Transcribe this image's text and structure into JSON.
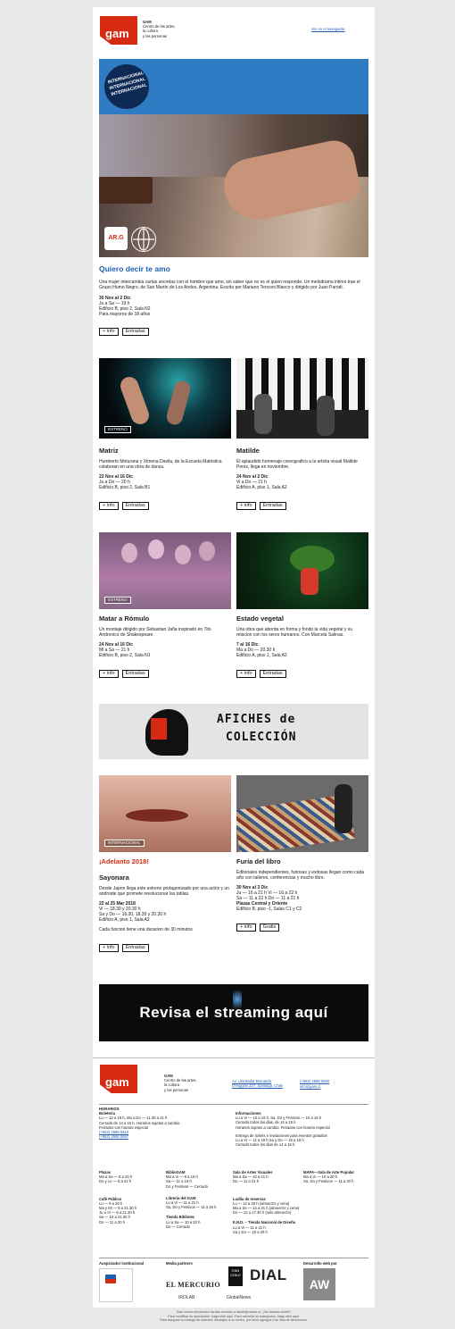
{
  "header": {
    "org": "GAM",
    "org_lines": [
      "Centro de las artes,",
      "la cultura",
      "y las personas"
    ],
    "browser_link": "Ver en el navegador"
  },
  "banner": {
    "stamp_word": "INTERNACIONAL"
  },
  "feature": {
    "title": "Quiero decir te amo",
    "desc": "Una mujer intercambia cartas secretas con el hombre que amo, sin saber que no es el quien responde. Un melodrama intimo trae el Grupo Humo Negro, de San Martin de Los Andes, Argentina. Escrito por Mariano Tenconi Blanco y dirigido por Juan Parodi.",
    "date": "30 Nov al 2 Dic",
    "times": "Ju a Sa — 19 h",
    "place": "Edificio B, piso 2, Sala N2",
    "age": "Para mayores de 18 años",
    "logo_text": "AR.G"
  },
  "buttons": {
    "info": "+ info",
    "tickets": "Entradas",
    "free": "Gratis"
  },
  "badges": {
    "estreno": "ESTRENO",
    "internacional": "INTERNACIONAL"
  },
  "events": [
    {
      "title": "Matriz",
      "desc": "Humberto Moturana y Ximena Davila, de la Escuela Matristica colaboran en una obra de danza.",
      "date": "22 Nov al 16 Dic",
      "times": "Ju a Do — 20 h",
      "place": "Edificio B, piso 2, Sala B1"
    },
    {
      "title": "Matilde",
      "desc": "El aplaudido homenaje coreografico a la artista visual Matilde Perez, llega en noviembre.",
      "date": "24 Nov al 2 Dic",
      "times": "Vi a Do — 21 h",
      "place": "Edificio A, piso 1, Sala A2"
    },
    {
      "title": "Matar a Rómulo",
      "desc": "Un montaje dirigido por Sebastian Jaña inspirado en Tito Andronico de Shakespeare.",
      "date": "24 Nov al 16 Dic",
      "times": "Mi a Sa — 21 h",
      "place": "Edificio B, piso 2, Sala N1"
    },
    {
      "title": "Estado vegetal",
      "desc": "Una obra que aborda en forma y fondo la vida vegetal y su relacion con los seres humanos. Con Marcela Salinas.",
      "date": "7 al 16 Dic",
      "times": "Ma a Do — 20.30 h",
      "place": "Edificio A, piso 1, Sala A2"
    }
  ],
  "afiches": {
    "line1": "AFICHES de",
    "line2": "COLECCIÓN"
  },
  "sayonara": {
    "kicker": "¡Adelanto 2018!",
    "title": "Sayonara",
    "desc": "Desde Japon llega este estreno protagonizado por una actriz y un androide que promete revolucionar las tablas.",
    "date": "22 al 25 Mar 2018",
    "times": [
      "Vi — 18.30 y 20.30 h",
      "Sa y Do — 16.30, 18.30 y 20.30 h"
    ],
    "place": "Edificio A, piso 1, Sala A2",
    "note": "Cada funcion tiene una duracion de 30 minutos"
  },
  "furia": {
    "title": "Furia del libro",
    "desc": "Editoriales independientes, furiosas y exitosas llegan como cada año con talleres, conferencias y mucho libro.",
    "date": "30 Nov al 3 Dic",
    "times": [
      "Ju — 16 a 21 h  Vi — 16 a 22 h",
      "Sa — 11 a 22 h  Do — 11 a 21 h"
    ],
    "place_title": "Plazas Central y Oriente",
    "place": "Edificio B, piso -1, Salas C1 y C2"
  },
  "streaming": {
    "text": "Revisa el streaming aquí"
  },
  "footer": {
    "address": "Av. Libertador Bernardo O'Higgins 227, Santiago, Chile",
    "phone": "(+562) 2566 5500",
    "email": "info@gam.cl",
    "horarios_title": "HORARIOS",
    "boleteria": "Boleteria",
    "boleteria_lines": [
      "Lu — 12 a 19 h, Ma a Do — 11.30 a 21 h",
      "Cerrado de 14 a 15 h. Horarios sujetos a cambio.",
      "Feriados con horario especial",
      "(+562) 2566 5510",
      "(+562) 2566 5557"
    ],
    "internaciones": "Informaciones",
    "inter_lines": [
      "Lu a Vi — 10 a 19 h, Sa, Do y Festivos — 10 a 18 h",
      "Cerrado todos los dias, de 14 a 15 h",
      "Horarios sujetos a cambio. Feriados con horario especial",
      "Entrega de tickets e invitaciones para eventos gratuitos",
      "Lu a Vi — 11 a 18 h  Sa y Do — 15 a 19 h",
      "Cerrado todos los dias de 14 a 15 h"
    ],
    "col_a": [
      {
        "title": "Plazas",
        "lines": [
          "Ma a Sa — 8 a 23 h",
          "Do y Lu — 8 a 22 h"
        ]
      },
      {
        "title": "Café Público",
        "lines": [
          "Lu — 9 a 20 h",
          "Ma y Mi — 9 a 21.30 h",
          "Ju a Vi — 9 a 21.30 h",
          "Sa — 10 a 21.30 h",
          "Do — 11 a 20 h"
        ]
      }
    ],
    "col_b": [
      {
        "title": "BiblioGAM",
        "lines": [
          "Ma a Vi — 9 a 19 h",
          "Sa — 11 a 19 h",
          "Do y Festivos — Cerrado"
        ]
      },
      {
        "title": "Librería del GAM",
        "lines": [
          "Lu a Vi — 11 a 21 h",
          "Sa, Do y Festivos — 11 a 20 h"
        ]
      },
      {
        "title": "Tienda Bibliotec",
        "lines": [
          "Lu a Sa — 10 a 20 h",
          "Do — Cerrado"
        ]
      }
    ],
    "col_c": [
      {
        "title": "Sala de Artes Visuales",
        "lines": [
          "Ma a Sa — 10 a 21 h",
          "Do — 11 a 21 h"
        ]
      },
      {
        "title": "Ludila de reservas",
        "lines": [
          "Lu — 12 a 20 h (almuerzo y cena)",
          "Ma a Sa — 12 a 21 h (almuerzo y cena)",
          "Do — 12 a 17.30 h (solo almuerzo)"
        ]
      },
      {
        "title": "E.N.D. – Tienda Nacional de Diseño",
        "lines": [
          "Lu a Vi — 11 a 21 h",
          "Sa y Do — 10 a 20 h"
        ]
      }
    ],
    "col_d": [
      {
        "title": "MAPA—Sala de Arte Popular",
        "lines": [
          "Ma a Vi — 10 a 20 h",
          "Sa, Do y Festivos — 11 a 20 h"
        ]
      }
    ],
    "sponsor_title": "Auspiciador institucional",
    "partners_title": "Media partners",
    "dev_title": "Desarrollo web por",
    "partners": [
      "EL MERCURIO",
      "CNN CHILE",
      "DIAL",
      "IROLAB",
      "GlobalNews"
    ],
    "dev": "AW",
    "legal": [
      "Este correo electronico ha sido enviado a daniel@correo.cl. ¿No deseas recibir?",
      "Para modificar su suscripcion, haga click aqui. Para cancelar su suscripcion, haga click aqui.",
      "Para asegurar la entrega de nuestros mensajes a su correo, por favor agregue a su lista de direcciones."
    ]
  },
  "colors": {
    "brand": "#d62b12",
    "link": "#1f5fb3",
    "banner": "#2f7bc4"
  }
}
